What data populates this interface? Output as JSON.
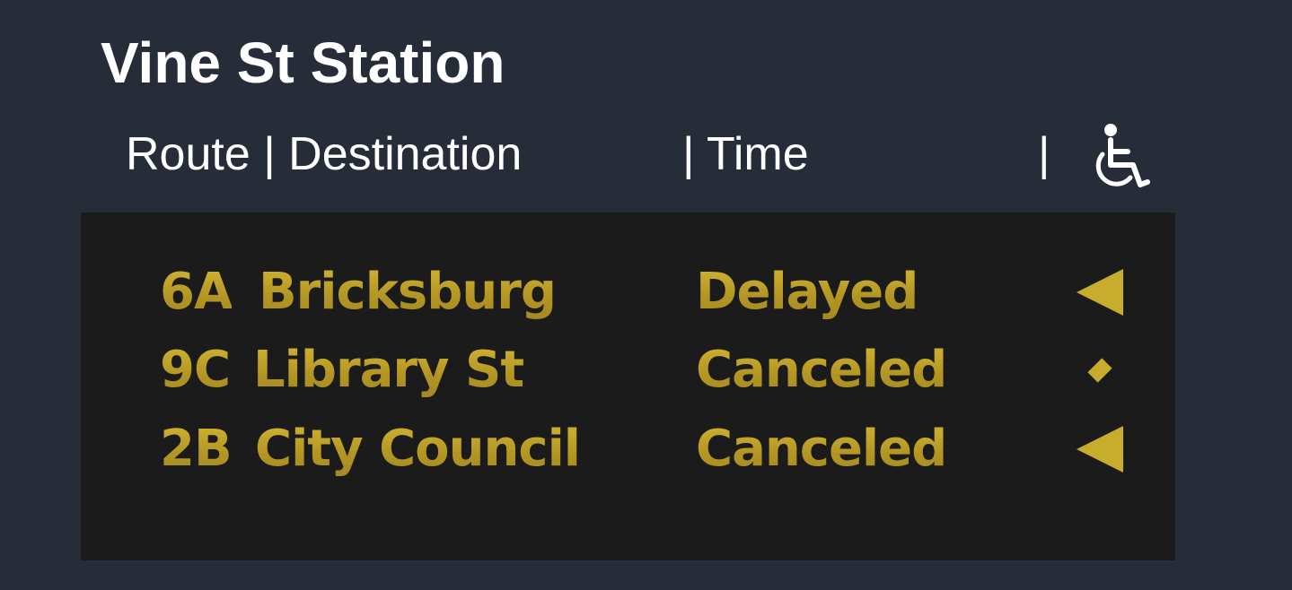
{
  "station": {
    "title": "Vine St Station"
  },
  "header": {
    "route_destination_label": "Route | Destination",
    "time_label": "|  Time",
    "separator_label": "|",
    "accessibility_icon": "wheelchair-icon"
  },
  "colors": {
    "background": "#272c39",
    "board": "#1b1b1b",
    "accent_gold": "#c8ac2b",
    "header_text": "#ffffff"
  },
  "departures": [
    {
      "route": "6A",
      "destination": "Bricksburg",
      "status": "Delayed",
      "marker": "left-arrow-icon"
    },
    {
      "route": "9C",
      "destination": "Library St",
      "status": "Canceled",
      "marker": "diamond-icon"
    },
    {
      "route": "2B",
      "destination": "City Council",
      "status": "Canceled",
      "marker": "left-arrow-icon"
    }
  ]
}
